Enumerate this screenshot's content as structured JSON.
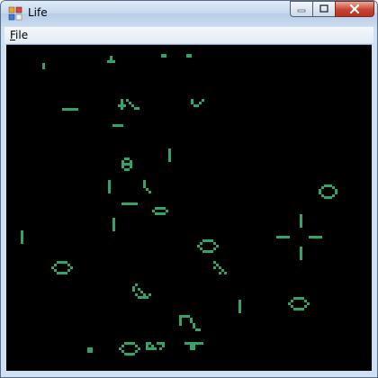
{
  "window": {
    "title": "Life",
    "controls": {
      "minimize": "minimize-icon",
      "maximize": "maximize-icon",
      "close": "close-icon"
    }
  },
  "menubar": {
    "file_label": "File",
    "file_mnemonic": "F",
    "file_rest": "ile"
  },
  "board": {
    "background_color": "#000000",
    "cell_color": "#2ea66a",
    "cells": [
      [
        40,
        20
      ],
      [
        40,
        21
      ],
      [
        40,
        22
      ],
      [
        40,
        23
      ],
      [
        40,
        24
      ],
      [
        115,
        12
      ],
      [
        115,
        13
      ],
      [
        115,
        14
      ],
      [
        112,
        17
      ],
      [
        115,
        17
      ],
      [
        118,
        17
      ],
      [
        172,
        10
      ],
      [
        172,
        11
      ],
      [
        175,
        10
      ],
      [
        175,
        11
      ],
      [
        200,
        10
      ],
      [
        200,
        11
      ],
      [
        203,
        10
      ],
      [
        203,
        11
      ],
      [
        62,
        70
      ],
      [
        65,
        70
      ],
      [
        68,
        70
      ],
      [
        71,
        70
      ],
      [
        74,
        70
      ],
      [
        77,
        70
      ],
      [
        127,
        60
      ],
      [
        127,
        63
      ],
      [
        127,
        66
      ],
      [
        127,
        69
      ],
      [
        124,
        66
      ],
      [
        130,
        66
      ],
      [
        133,
        60
      ],
      [
        136,
        63
      ],
      [
        139,
        66
      ],
      [
        142,
        69
      ],
      [
        145,
        69
      ],
      [
        118,
        88
      ],
      [
        121,
        88
      ],
      [
        124,
        88
      ],
      [
        127,
        88
      ],
      [
        205,
        60
      ],
      [
        205,
        63
      ],
      [
        208,
        66
      ],
      [
        211,
        66
      ],
      [
        214,
        63
      ],
      [
        217,
        60
      ],
      [
        180,
        115
      ],
      [
        180,
        118
      ],
      [
        180,
        121
      ],
      [
        180,
        124
      ],
      [
        180,
        127
      ],
      [
        128,
        128
      ],
      [
        131,
        125
      ],
      [
        134,
        125
      ],
      [
        137,
        128
      ],
      [
        131,
        131
      ],
      [
        134,
        131
      ],
      [
        128,
        131
      ],
      [
        137,
        131
      ],
      [
        131,
        137
      ],
      [
        134,
        137
      ],
      [
        128,
        134
      ],
      [
        137,
        134
      ],
      [
        113,
        150
      ],
      [
        113,
        153
      ],
      [
        113,
        156
      ],
      [
        113,
        159
      ],
      [
        113,
        162
      ],
      [
        152,
        150
      ],
      [
        152,
        153
      ],
      [
        152,
        156
      ],
      [
        155,
        159
      ],
      [
        158,
        162
      ],
      [
        128,
        175
      ],
      [
        131,
        175
      ],
      [
        134,
        175
      ],
      [
        137,
        175
      ],
      [
        140,
        175
      ],
      [
        143,
        175
      ],
      [
        162,
        183
      ],
      [
        165,
        180
      ],
      [
        168,
        180
      ],
      [
        171,
        180
      ],
      [
        174,
        180
      ],
      [
        177,
        183
      ],
      [
        165,
        186
      ],
      [
        168,
        186
      ],
      [
        171,
        186
      ],
      [
        174,
        186
      ],
      [
        347,
        160
      ],
      [
        350,
        157
      ],
      [
        353,
        155
      ],
      [
        356,
        155
      ],
      [
        359,
        155
      ],
      [
        362,
        157
      ],
      [
        365,
        160
      ],
      [
        347,
        163
      ],
      [
        350,
        166
      ],
      [
        353,
        168
      ],
      [
        356,
        168
      ],
      [
        359,
        168
      ],
      [
        362,
        166
      ],
      [
        365,
        163
      ],
      [
        118,
        192
      ],
      [
        118,
        195
      ],
      [
        118,
        198
      ],
      [
        118,
        201
      ],
      [
        118,
        204
      ],
      [
        16,
        206
      ],
      [
        16,
        209
      ],
      [
        16,
        212
      ],
      [
        16,
        215
      ],
      [
        16,
        218
      ],
      [
        326,
        188
      ],
      [
        326,
        191
      ],
      [
        326,
        194
      ],
      [
        326,
        197
      ],
      [
        326,
        200
      ],
      [
        300,
        212
      ],
      [
        303,
        212
      ],
      [
        306,
        212
      ],
      [
        309,
        212
      ],
      [
        312,
        212
      ],
      [
        336,
        212
      ],
      [
        339,
        212
      ],
      [
        342,
        212
      ],
      [
        345,
        212
      ],
      [
        348,
        212
      ],
      [
        326,
        224
      ],
      [
        326,
        227
      ],
      [
        326,
        230
      ],
      [
        326,
        233
      ],
      [
        326,
        236
      ],
      [
        212,
        222
      ],
      [
        215,
        219
      ],
      [
        218,
        216
      ],
      [
        221,
        216
      ],
      [
        224,
        216
      ],
      [
        227,
        216
      ],
      [
        230,
        219
      ],
      [
        233,
        222
      ],
      [
        215,
        225
      ],
      [
        218,
        228
      ],
      [
        221,
        228
      ],
      [
        224,
        228
      ],
      [
        227,
        228
      ],
      [
        230,
        225
      ],
      [
        50,
        246
      ],
      [
        53,
        243
      ],
      [
        56,
        240
      ],
      [
        59,
        240
      ],
      [
        62,
        240
      ],
      [
        65,
        240
      ],
      [
        68,
        243
      ],
      [
        71,
        246
      ],
      [
        53,
        249
      ],
      [
        56,
        252
      ],
      [
        59,
        252
      ],
      [
        62,
        252
      ],
      [
        65,
        252
      ],
      [
        68,
        249
      ],
      [
        230,
        240
      ],
      [
        233,
        243
      ],
      [
        236,
        246
      ],
      [
        230,
        246
      ],
      [
        236,
        252
      ],
      [
        239,
        249
      ],
      [
        242,
        252
      ],
      [
        140,
        268
      ],
      [
        143,
        265
      ],
      [
        146,
        270
      ],
      [
        149,
        273
      ],
      [
        152,
        276
      ],
      [
        155,
        279
      ],
      [
        140,
        271
      ],
      [
        143,
        276
      ],
      [
        146,
        279
      ],
      [
        149,
        279
      ],
      [
        152,
        279
      ],
      [
        158,
        276
      ],
      [
        258,
        283
      ],
      [
        258,
        286
      ],
      [
        258,
        289
      ],
      [
        258,
        292
      ],
      [
        258,
        295
      ],
      [
        313,
        286
      ],
      [
        316,
        283
      ],
      [
        319,
        280
      ],
      [
        322,
        280
      ],
      [
        325,
        280
      ],
      [
        328,
        280
      ],
      [
        331,
        283
      ],
      [
        334,
        286
      ],
      [
        316,
        289
      ],
      [
        319,
        292
      ],
      [
        322,
        292
      ],
      [
        325,
        292
      ],
      [
        328,
        292
      ],
      [
        331,
        289
      ],
      [
        192,
        300
      ],
      [
        195,
        300
      ],
      [
        198,
        300
      ],
      [
        201,
        300
      ],
      [
        192,
        303
      ],
      [
        192,
        306
      ],
      [
        192,
        309
      ],
      [
        204,
        303
      ],
      [
        204,
        306
      ],
      [
        207,
        309
      ],
      [
        207,
        312
      ],
      [
        210,
        315
      ],
      [
        213,
        315
      ],
      [
        90,
        336
      ],
      [
        93,
        336
      ],
      [
        90,
        339
      ],
      [
        93,
        339
      ],
      [
        125,
        336
      ],
      [
        128,
        333
      ],
      [
        131,
        330
      ],
      [
        134,
        330
      ],
      [
        137,
        330
      ],
      [
        140,
        330
      ],
      [
        143,
        333
      ],
      [
        146,
        336
      ],
      [
        128,
        339
      ],
      [
        131,
        342
      ],
      [
        134,
        342
      ],
      [
        137,
        342
      ],
      [
        140,
        342
      ],
      [
        143,
        339
      ],
      [
        155,
        330
      ],
      [
        158,
        330
      ],
      [
        155,
        333
      ],
      [
        155,
        336
      ],
      [
        158,
        336
      ],
      [
        161,
        336
      ],
      [
        164,
        336
      ],
      [
        161,
        333
      ],
      [
        167,
        330
      ],
      [
        170,
        330
      ],
      [
        173,
        330
      ],
      [
        173,
        333
      ],
      [
        170,
        336
      ],
      [
        198,
        330
      ],
      [
        201,
        330
      ],
      [
        204,
        330
      ],
      [
        207,
        330
      ],
      [
        210,
        330
      ],
      [
        213,
        330
      ],
      [
        216,
        330
      ],
      [
        204,
        333
      ],
      [
        207,
        333
      ],
      [
        204,
        336
      ],
      [
        207,
        336
      ]
    ]
  }
}
